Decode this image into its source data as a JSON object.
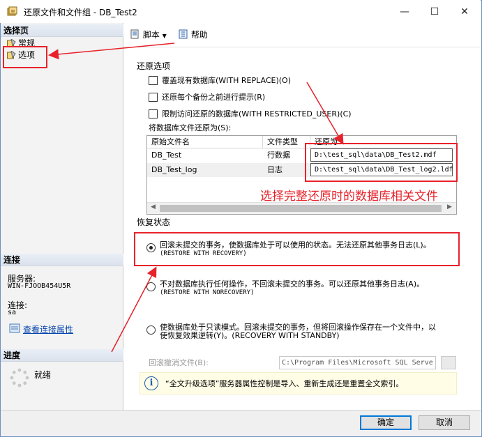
{
  "window": {
    "title": "还原文件和文件组 - DB_Test2",
    "controls": [
      "minimize",
      "maximize",
      "close"
    ]
  },
  "left_panel": {
    "select_page_header": "选择页",
    "pages": [
      {
        "label": "常规",
        "icon": "page-icon"
      },
      {
        "label": "选项",
        "icon": "page-icon"
      }
    ],
    "connection_header": "连接",
    "server_label": "服务器:",
    "server_value": "WIN-FJOOB454U5R",
    "connect_label": "连接:",
    "connect_value": "sa",
    "view_props_link": "查看连接属性",
    "progress_header": "进度",
    "progress_status": "就绪"
  },
  "toolbar": {
    "script_label": "脚本",
    "help_label": "帮助"
  },
  "restore_options": {
    "group_title": "还原选项",
    "checkboxes": [
      {
        "label": "覆盖现有数据库(WITH REPLACE)(O)",
        "checked": false
      },
      {
        "label": "还原每个备份之前进行提示(R)",
        "checked": false
      },
      {
        "label": "限制访问还原的数据库(WITH RESTRICTED_USER)(C)",
        "checked": false
      }
    ],
    "restore_as_label": "将数据库文件还原为(S):",
    "grid_headers": [
      "原始文件名",
      "文件类型",
      "还原为"
    ],
    "grid_rows": [
      {
        "original": "DB_Test",
        "type": "行数据",
        "restore_as": "D:\\test_sql\\data\\DB_Test2.mdf"
      },
      {
        "original": "DB_Test_log",
        "type": "日志",
        "restore_as": "D:\\test_sql\\data\\DB_Test_log2.ldf"
      }
    ]
  },
  "annotation": {
    "callout_text": "选择完整还原时的数据库相关文件",
    "color": "#e8222a"
  },
  "recovery_state": {
    "group_title": "恢复状态",
    "options": [
      {
        "line1": "回滚未提交的事务，使数据库处于可以使用的状态。无法还原其他事务日志(L)。",
        "line2": "(RESTORE WITH RECOVERY)",
        "selected": true
      },
      {
        "line1": "不对数据库执行任何操作，不回滚未提交的事务。可以还原其他事务日志(A)。",
        "line2": "(RESTORE WITH NORECOVERY)",
        "selected": false
      },
      {
        "line1": "使数据库处于只读模式。回滚未提交的事务，但将回滚操作保存在一个文件中，以",
        "line2": "使恢复效果逆转(Y)。(RECOVERY WITH STANDBY)",
        "selected": false
      }
    ],
    "undo_file_label": "回滚撤消文件(B):",
    "undo_file_value": "C:\\Program Files\\Microsoft SQL Serve"
  },
  "info_bar": {
    "icon": "info-icon",
    "text": "“全文升级选项”服务器属性控制是导入、重新生成还是重置全文索引。"
  },
  "footer": {
    "ok_label": "确定",
    "cancel_label": "取消"
  }
}
